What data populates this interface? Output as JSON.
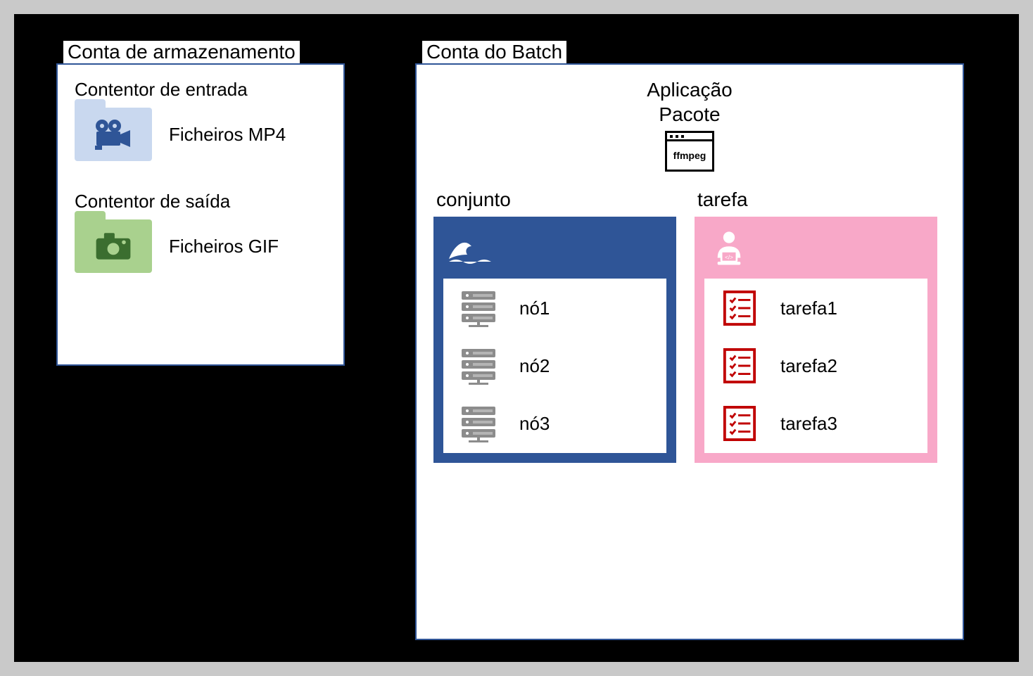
{
  "storage": {
    "header": "Conta de armazenamento",
    "input": {
      "title": "Contentor de entrada",
      "file_label": "Ficheiros MP4"
    },
    "output": {
      "title": "Contentor de saída",
      "file_label": "Ficheiros GIF"
    }
  },
  "batch": {
    "header": "Conta do Batch",
    "app": {
      "line1": "Aplicação",
      "line2": "Pacote",
      "package_name": "ffmpeg"
    },
    "pool": {
      "heading": "conjunto",
      "nodes": [
        "nó1",
        "nó2",
        "nó3"
      ]
    },
    "job": {
      "heading": "tarefa",
      "tasks": [
        "tarefa1",
        "tarefa2",
        "tarefa3"
      ]
    }
  }
}
